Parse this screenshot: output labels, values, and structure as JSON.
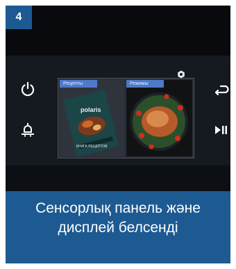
{
  "step": {
    "number": "4"
  },
  "display": {
    "tiles": [
      {
        "label": "Рецепты"
      },
      {
        "label": "Режимы"
      }
    ],
    "book_brand": "polaris",
    "book_title": "КНИГА РЕЦЕПТОВ"
  },
  "icons": {
    "power": "power-icon",
    "light": "lamp-icon",
    "back": "back-arrow-icon",
    "play_pause": "play-pause-icon",
    "settings": "settings-icon"
  },
  "caption": {
    "line1": "Сенсорлық панель және",
    "line2": "дисплей белсенді"
  },
  "colors": {
    "accent": "#1d5a92",
    "tile_label": "#4d79c9",
    "panel": "#0b0e13"
  }
}
